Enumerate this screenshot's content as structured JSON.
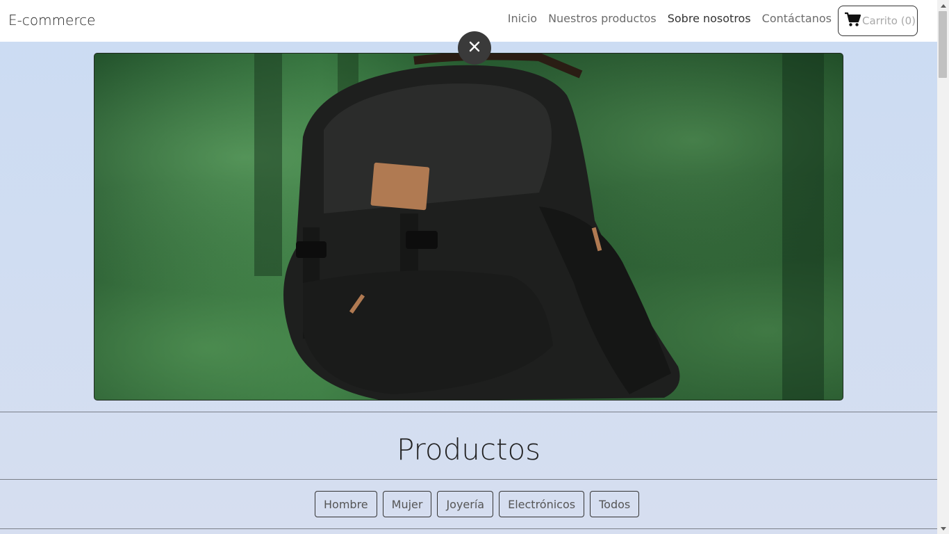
{
  "navbar": {
    "brand": "E-commerce",
    "links": [
      {
        "label": "Inicio"
      },
      {
        "label": "Nuestros productos"
      },
      {
        "label": "Sobre nosotros"
      },
      {
        "label": "Contáctanos"
      }
    ],
    "cart_label": "Carrito (0)",
    "cart_icon": "shopping-cart-icon"
  },
  "hero": {
    "image": "backpack-forest-photo",
    "close_icon": "close-icon"
  },
  "products": {
    "title": "Productos",
    "filters": [
      {
        "label": "Hombre"
      },
      {
        "label": "Mujer"
      },
      {
        "label": "Joyería"
      },
      {
        "label": "Electrónicos"
      },
      {
        "label": "Todos"
      }
    ]
  },
  "colors": {
    "page_background": "#cbdcf3",
    "navbar_background": "#ffffff",
    "close_button": "#3a3a3a"
  }
}
